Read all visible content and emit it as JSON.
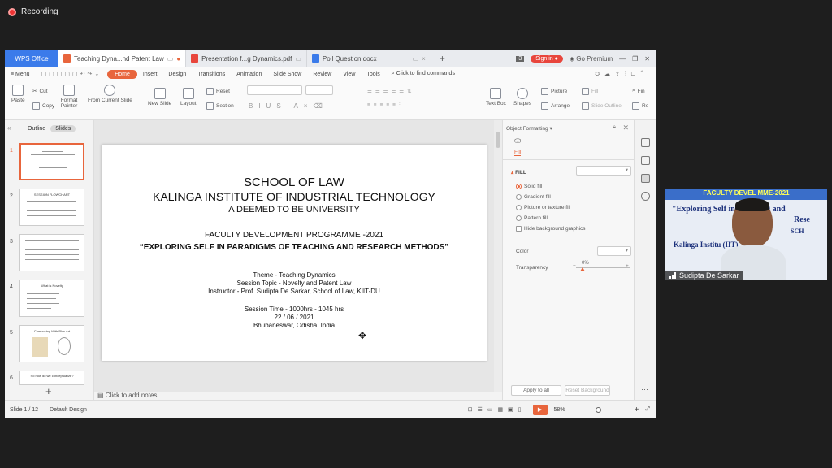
{
  "recording": {
    "label": "Recording"
  },
  "tabs": [
    {
      "label": "WPS Office"
    },
    {
      "label": "Teaching Dyna...nd Patent Law"
    },
    {
      "label": "Presentation f...g Dynamics.pdf"
    },
    {
      "label": "Poll Question.docx"
    }
  ],
  "tabbar": {
    "count": "3",
    "sign_in": "Sign in",
    "go_premium": "Go Premium"
  },
  "menu": [
    "Menu",
    "Home",
    "Insert",
    "Design",
    "Transitions",
    "Animation",
    "Slide Show",
    "Review",
    "View",
    "Tools"
  ],
  "search": {
    "placeholder": "Click to find commands"
  },
  "ribbon": {
    "paste": "Paste",
    "cut": "Cut",
    "copy": "Copy",
    "format_painter": "Format Painter",
    "from_current_slide": "From Current Slide",
    "new_slide": "New Slide",
    "layout": "Layout",
    "reset": "Reset",
    "section": "Section",
    "text_box": "Text Box",
    "shapes": "Shapes",
    "picture": "Picture",
    "fill": "Fill",
    "arrange": "Arrange",
    "slide_outline": "Slide Outline",
    "find": "Fin",
    "replace": "Re"
  },
  "left_panel": {
    "outline": "Outline",
    "slides": "Slides"
  },
  "thumbnails": [
    {
      "num": "1",
      "title": ""
    },
    {
      "num": "2",
      "title": "SESSION FLOWCHART"
    },
    {
      "num": "3",
      "title": ""
    },
    {
      "num": "4",
      "title": "What is Novelty"
    },
    {
      "num": "5",
      "title": "Composing With Plus Art"
    },
    {
      "num": "6",
      "title": "So how do we conceptualize?"
    }
  ],
  "slide": {
    "line1": "SCHOOL OF LAW",
    "line2": "KALINGA INSTITUTE OF INDUSTRIAL TECHNOLOGY",
    "line3": "A DEEMED TO BE UNIVERSITY",
    "fdp": "FACULTY DEVELOPMENT PROGRAMME -2021",
    "theme": "“EXPLORING SELF IN PARADIGMS OF TEACHING AND RESEARCH METHODS”",
    "lines": [
      "Theme - Teaching Dynamics",
      "Session Topic - Novelty and Patent Law",
      "Instructor - Prof. Sudipta De Sarkar, School of Law, KIIT-DU",
      "",
      "Session Time - 1000hrs - 1045 hrs",
      "22 / 06 / 2021",
      "Bhubaneswar, Odisha, India"
    ]
  },
  "notes": {
    "placeholder": "Click to add notes"
  },
  "format_panel": {
    "title": "Object Formatting",
    "fill_tab": "Fill",
    "fill_section": "FILL",
    "options": [
      "Solid fill",
      "Gradient fill",
      "Picture or texture fill",
      "Pattern fill"
    ],
    "selected_option": "Solid fill",
    "hide_bg": "Hide background graphics",
    "color": "Color",
    "transparency": "Transparency",
    "transparency_value": "0%",
    "apply_all": "Apply to all",
    "reset_bg": "Reset Background"
  },
  "status": {
    "slide": "Slide 1 / 12",
    "design": "Default Design",
    "zoom": "58%"
  },
  "video": {
    "banner": "FACULTY DEVEL         MME-2021",
    "line1": "\"Exploring Self in P          eaching and",
    "line2": "Rese",
    "line3": "SCH",
    "line4": "Kalinga Institu                 (IIT)",
    "name": "Sudipta De Sarkar"
  },
  "colors": {
    "accent": "#e8653c",
    "wps_blue": "#3b7bea",
    "signin": "#e8453c"
  }
}
